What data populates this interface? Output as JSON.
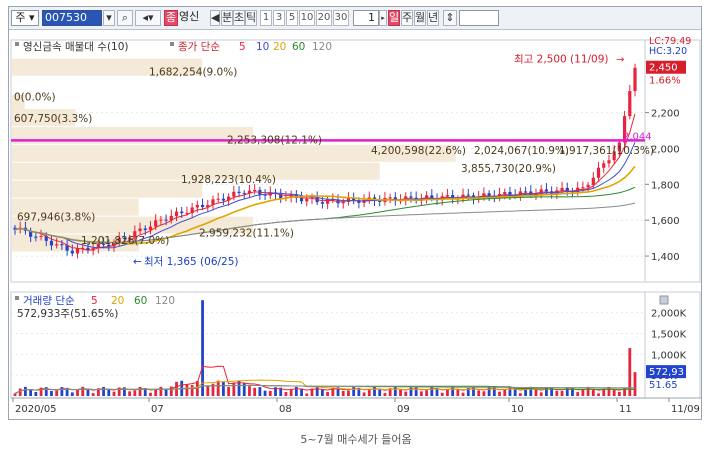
{
  "toolbar": {
    "market": "주",
    "code": "007530",
    "search_icon": "search-icon",
    "speaker_icon": "speaker-icon",
    "tag": "종",
    "name": "영신",
    "prev": "◀",
    "minute_label": "분",
    "tick_label": "초",
    "tick2_label": "틱",
    "periods": [
      "1",
      "3",
      "5",
      "10",
      "20",
      "30"
    ],
    "count": "1",
    "day_label": "일",
    "week_label": "주",
    "month_label": "월",
    "year_label": "년",
    "sort_icon": "sort-icon"
  },
  "price_panel": {
    "title": "영신금속 매물대 수(10)",
    "legend_prefix": "종가 단순",
    "ma_labels": [
      "5",
      "10",
      "20",
      "60",
      "120"
    ],
    "ma_colors": [
      "#e8243c",
      "#3e4fd3",
      "#e2a400",
      "#2b8a2b",
      "#8a8a8a"
    ],
    "volume_profile_labels": [
      "1,682,254(9.0%)",
      "0(0.0%)",
      "607,750(3.3%)",
      "2,253,308(12.1%)",
      "1,928,223(10.4%)",
      "697,946(3.8%)",
      "2,959,232(11.1%)",
      "1,201,826(7.0%)",
      "4,200,598(22.6%)",
      "2,024,067(10.9%)",
      "1,917,361(10.3%)",
      "3,855,730(20.9%)"
    ],
    "max_label": "최고 2,500 (11/09)",
    "min_label": "최저 1,365 (06/25)",
    "lc_label": "LC:79.49",
    "hc_label": "HC:3.20",
    "current_price": "2,450",
    "change_pct": "1.66%",
    "ref_price": "2,044",
    "y_ticks": [
      "2,200",
      "2,000",
      "1,800",
      "1,600",
      "1,400"
    ]
  },
  "volume_panel": {
    "title": "거래량 단순",
    "ma_labels": [
      "5",
      "20",
      "60",
      "120"
    ],
    "ma_colors": [
      "#e8243c",
      "#e2a400",
      "#2b8a2b",
      "#8a8a8a"
    ],
    "subtitle": "572,933주(51.65%)",
    "y_ticks": [
      "2,000K",
      "1,500K",
      "1,000K",
      "500K"
    ],
    "current_volume": "572,93",
    "volume_pct": "51.65"
  },
  "x_axis": {
    "labels": [
      "2020/05",
      "07",
      "08",
      "09",
      "10",
      "11",
      "11/09"
    ]
  },
  "caption": "5~7월 매수세가 들어옴",
  "colors": {
    "up": "#e8243c",
    "down": "#2244cc",
    "resistance": "#e020d0",
    "profile": "#f5e9d8"
  }
}
